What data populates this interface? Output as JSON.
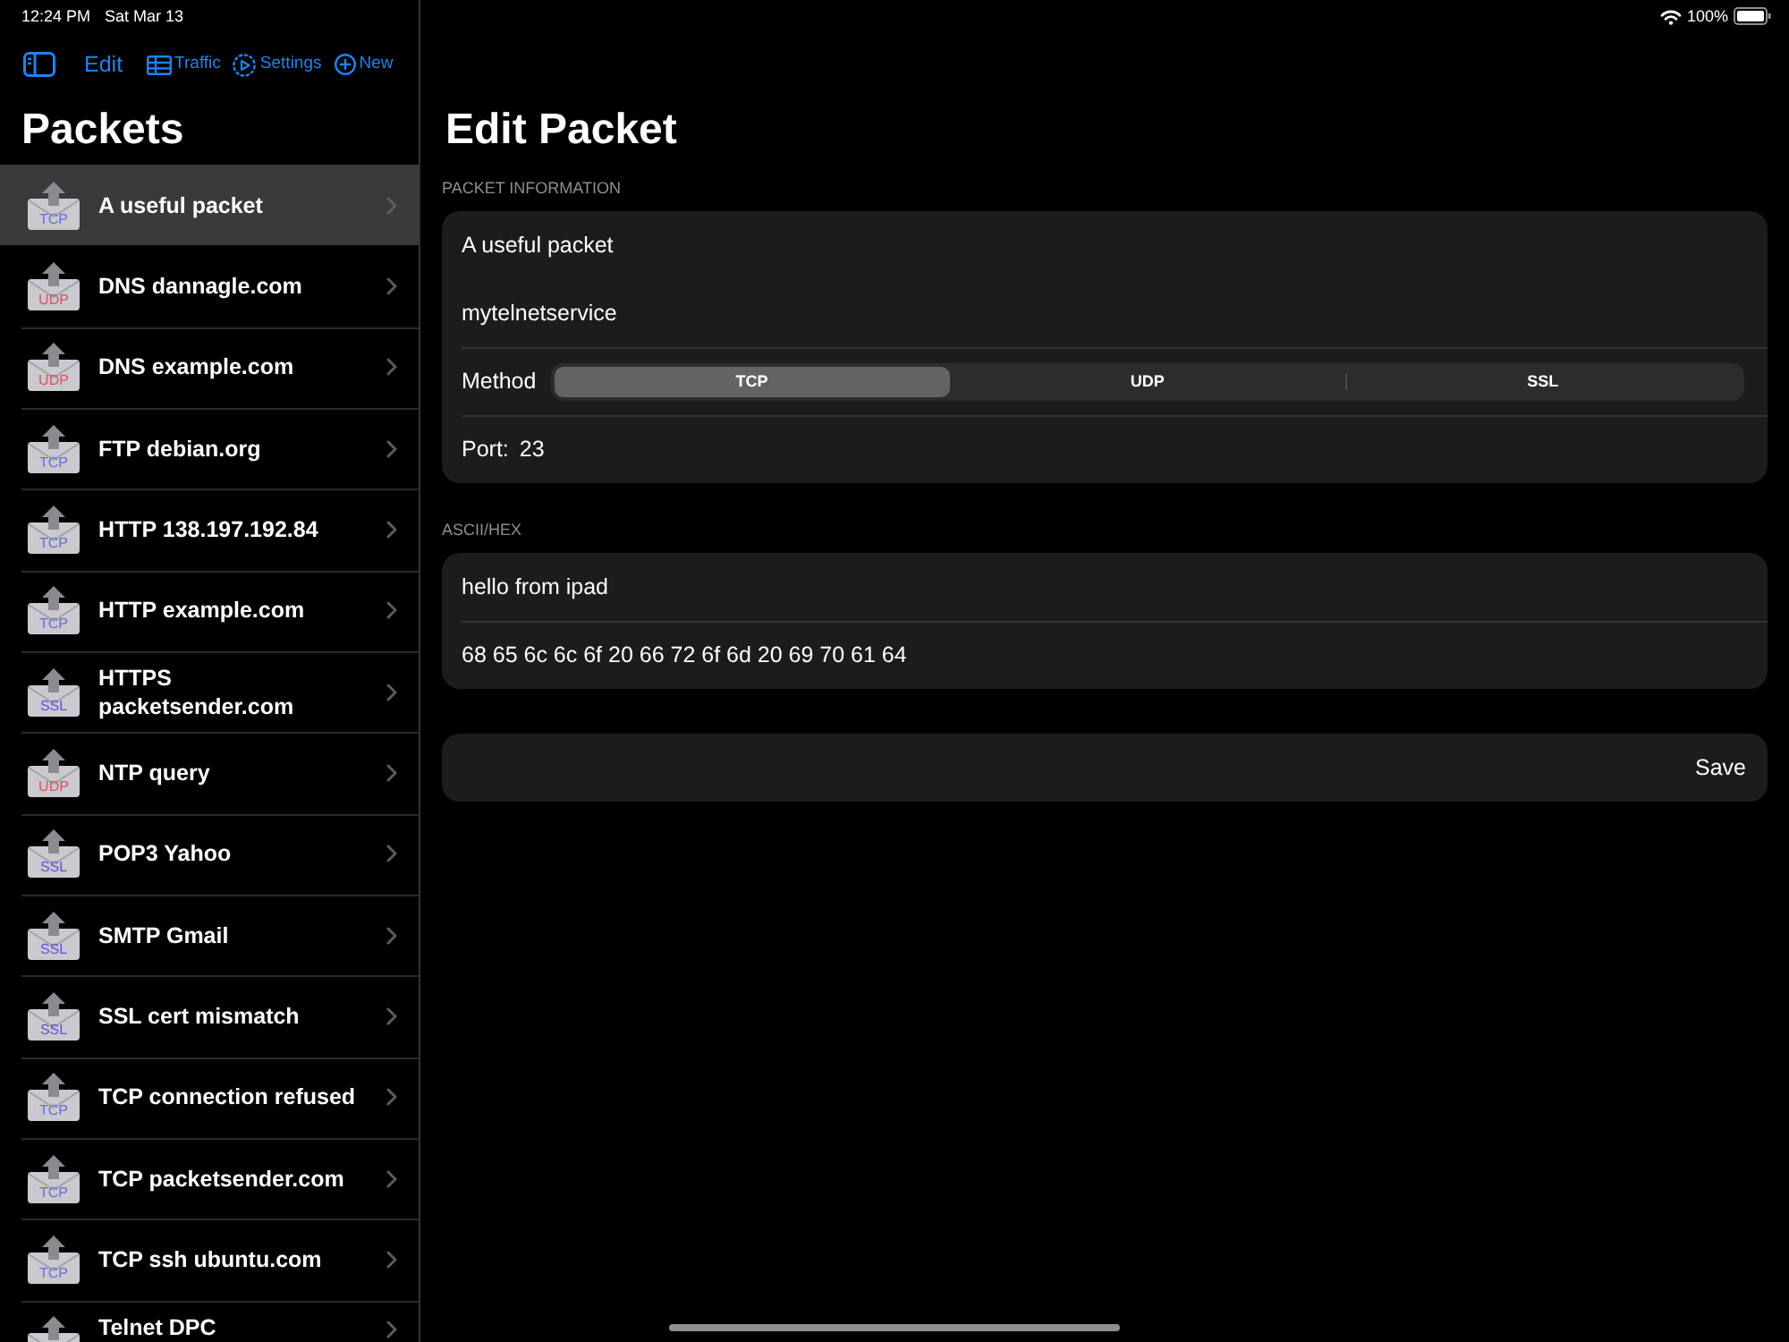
{
  "status_bar": {
    "time": "12:24 PM",
    "date": "Sat Mar 13",
    "battery": "100%"
  },
  "sidebar": {
    "toolbar": [
      {
        "kind": "sidebar"
      },
      {
        "kind": "edit",
        "label": "Edit"
      },
      {
        "kind": "traffic",
        "label": "Traffic"
      },
      {
        "kind": "settings",
        "label": "Settings"
      },
      {
        "kind": "new",
        "label": "New"
      }
    ],
    "title": "Packets",
    "packets": [
      {
        "name": "A useful packet",
        "protocol": "TCP",
        "color": "#6a6fd6",
        "selected": true
      },
      {
        "name": "DNS dannagle.com",
        "protocol": "UDP",
        "color": "#d9545c",
        "selected": false
      },
      {
        "name": "DNS example.com",
        "protocol": "UDP",
        "color": "#d9545c",
        "selected": false
      },
      {
        "name": "FTP debian.org",
        "protocol": "TCP",
        "color": "#6a6fd6",
        "selected": false
      },
      {
        "name": "HTTP 138.197.192.84",
        "protocol": "TCP",
        "color": "#6a6fd6",
        "selected": false
      },
      {
        "name": "HTTP example.com",
        "protocol": "TCP",
        "color": "#6a6fd6",
        "selected": false
      },
      {
        "name": "HTTPS packetsender.com",
        "protocol": "SSL",
        "color": "#6650d4",
        "selected": false
      },
      {
        "name": "NTP query",
        "protocol": "UDP",
        "color": "#d9545c",
        "selected": false
      },
      {
        "name": "POP3 Yahoo",
        "protocol": "SSL",
        "color": "#6650d4",
        "selected": false
      },
      {
        "name": "SMTP Gmail",
        "protocol": "SSL",
        "color": "#6650d4",
        "selected": false
      },
      {
        "name": "SSL cert mismatch",
        "protocol": "SSL",
        "color": "#6650d4",
        "selected": false
      },
      {
        "name": "TCP connection refused",
        "protocol": "TCP",
        "color": "#6a6fd6",
        "selected": false
      },
      {
        "name": "TCP packetsender.com",
        "protocol": "TCP",
        "color": "#6a6fd6",
        "selected": false
      },
      {
        "name": "TCP ssh ubuntu.com",
        "protocol": "TCP",
        "color": "#6a6fd6",
        "selected": false
      },
      {
        "name": "Telnet DPC",
        "selected": false
      }
    ]
  },
  "editor": {
    "title": "Edit Packet",
    "info_header": "PACKET INFORMATION",
    "name": "A useful packet",
    "host": "mytelnetservice",
    "method_label": "Method",
    "methods": [
      {
        "label": "TCP",
        "selected": true
      },
      {
        "label": "UDP",
        "selected": false
      },
      {
        "label": "SSL",
        "selected": false
      }
    ],
    "port_label": "Port:",
    "port": "23",
    "data_header": "ASCII/HEX",
    "ascii": "hello from ipad",
    "hex": "68 65 6c 6c 6f 20 66 72 6f 6d 20 69 70 61 64",
    "save": "Save"
  }
}
